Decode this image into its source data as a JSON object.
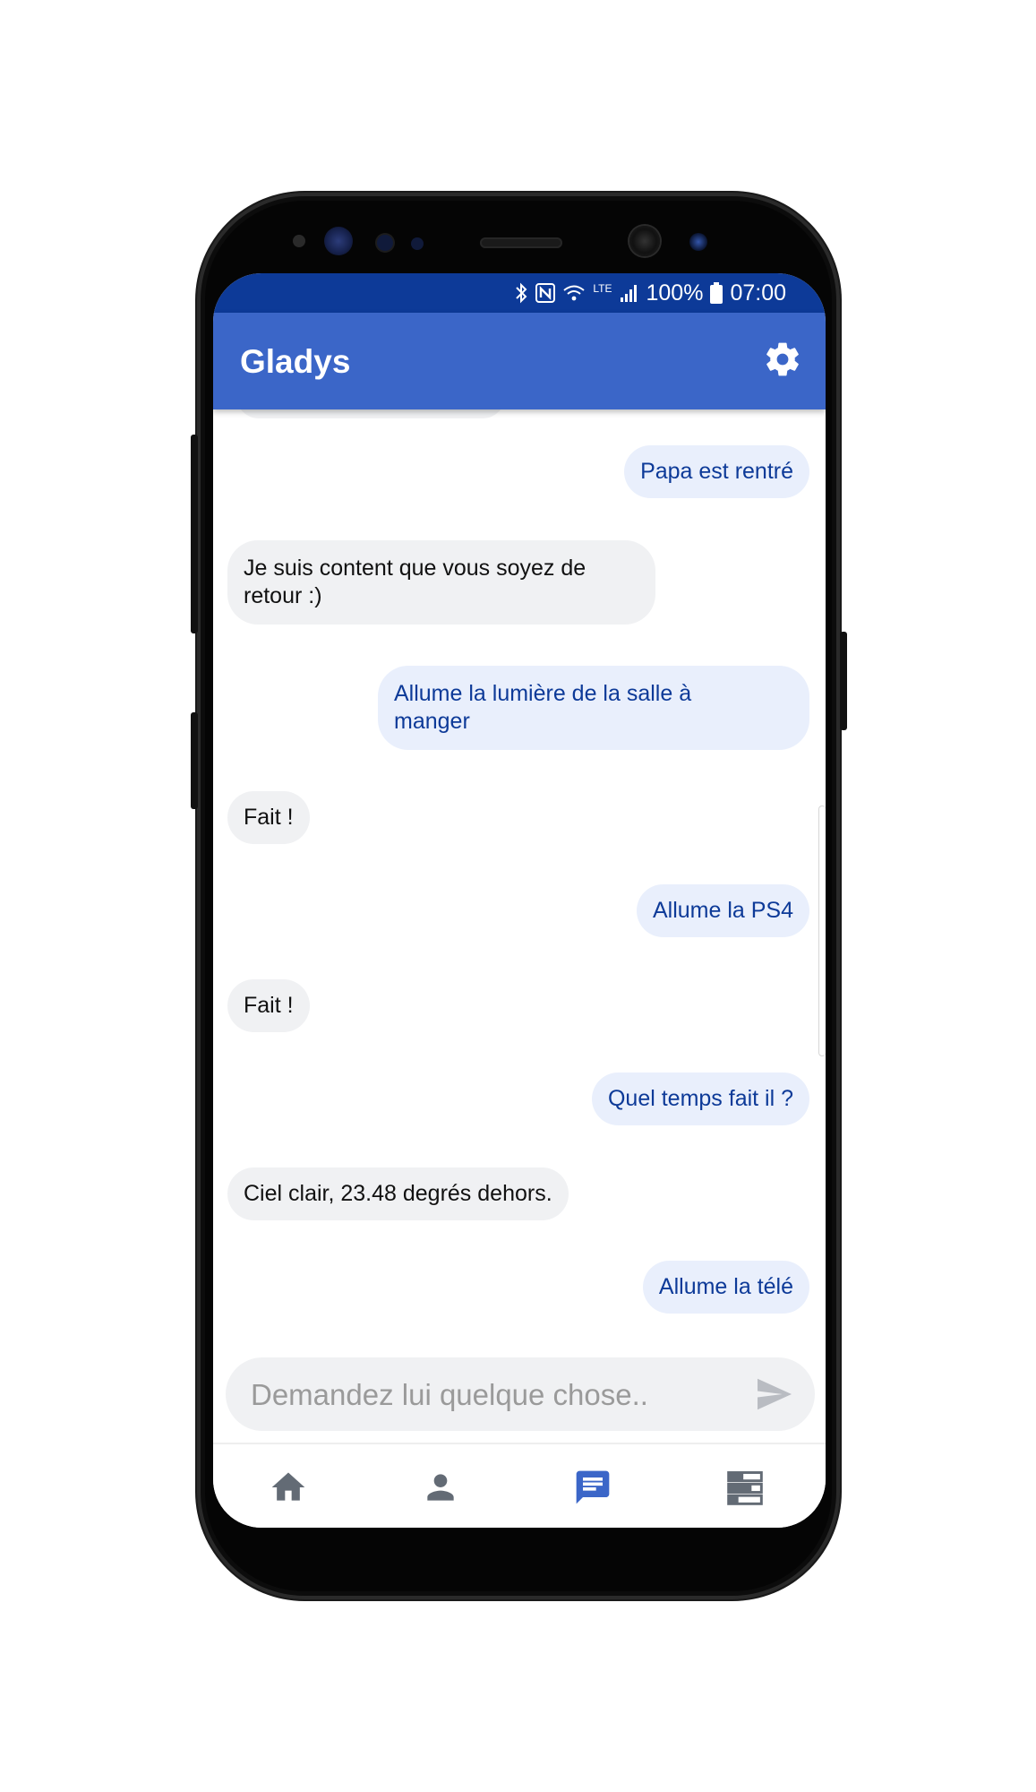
{
  "status_bar": {
    "battery": "100%",
    "time": "07:00",
    "network": "LTE"
  },
  "app_bar": {
    "title": "Gladys",
    "settings_icon": "gear-icon"
  },
  "messages": [
    {
      "from": "user",
      "text": "Papa est rentré"
    },
    {
      "from": "bot",
      "text": "Je suis content que vous soyez de retour :)"
    },
    {
      "from": "user",
      "text": "Allume la lumière de la salle à manger"
    },
    {
      "from": "bot",
      "text": "Fait !"
    },
    {
      "from": "user",
      "text": "Allume la PS4"
    },
    {
      "from": "bot",
      "text": "Fait !"
    },
    {
      "from": "user",
      "text": "Quel temps fait il ?"
    },
    {
      "from": "bot",
      "text": "Ciel clair, 23.48 degrés dehors."
    },
    {
      "from": "user",
      "text": "Allume la télé"
    }
  ],
  "composer": {
    "placeholder": "Demandez lui quelque chose..",
    "send_icon": "send-icon"
  },
  "bottom_nav": [
    {
      "icon": "home-icon",
      "active": false
    },
    {
      "icon": "person-icon",
      "active": false
    },
    {
      "icon": "chat-icon",
      "active": true
    },
    {
      "icon": "dashboard-icon",
      "active": false
    }
  ],
  "colors": {
    "primary": "#3b66c8",
    "primary_dark": "#0d3a98",
    "user_bubble": "#e9effc",
    "bot_bubble": "#f0f1f3",
    "nav_inactive": "#636b75"
  }
}
